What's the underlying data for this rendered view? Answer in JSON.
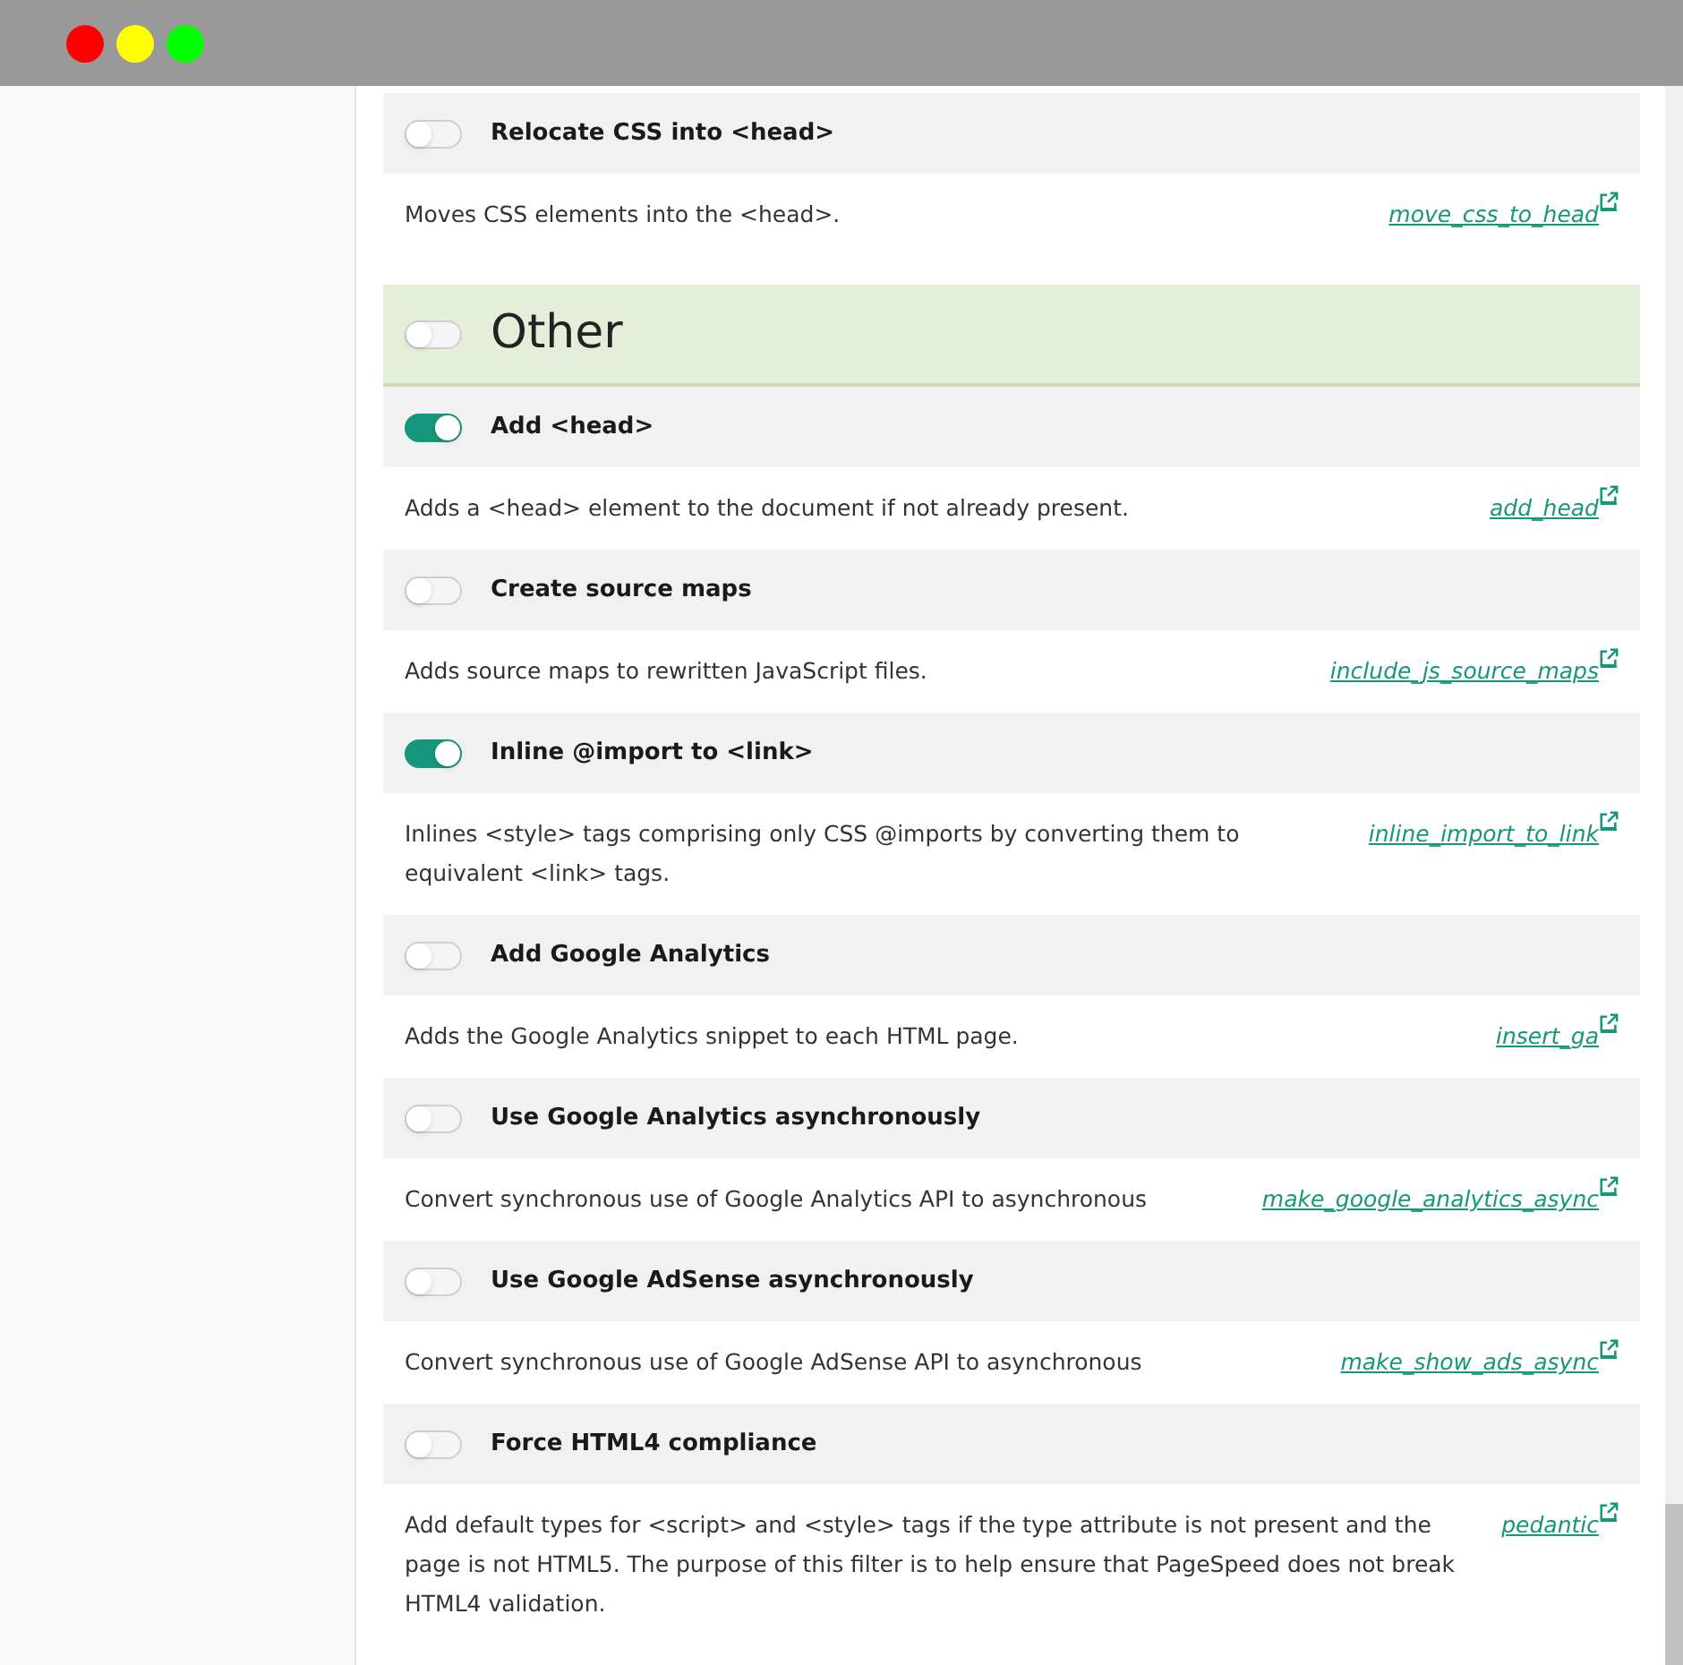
{
  "items": [
    {
      "kind": "filter",
      "title": "Relocate CSS into <head>",
      "on": false,
      "description": "Moves CSS elements into the <head>.",
      "link": "move_css_to_head"
    },
    {
      "kind": "section",
      "title": "Other",
      "on": false
    },
    {
      "kind": "filter",
      "title": "Add <head>",
      "on": true,
      "description": "Adds a <head> element to the document if not already present.",
      "link": "add_head"
    },
    {
      "kind": "filter",
      "title": "Create source maps",
      "on": false,
      "description": "Adds source maps to rewritten JavaScript files.",
      "link": "include_js_source_maps"
    },
    {
      "kind": "filter",
      "title": "Inline @import to <link>",
      "on": true,
      "description": "Inlines <style> tags comprising only CSS @imports by converting them to equivalent <link> tags.",
      "link": "inline_import_to_link"
    },
    {
      "kind": "filter",
      "title": "Add Google Analytics",
      "on": false,
      "description": "Adds the Google Analytics snippet to each HTML page.",
      "link": "insert_ga"
    },
    {
      "kind": "filter",
      "title": "Use Google Analytics asynchronously",
      "on": false,
      "description": "Convert synchronous use of Google Analytics API to asynchronous",
      "link": "make_google_analytics_async"
    },
    {
      "kind": "filter",
      "title": "Use Google AdSense asynchronously",
      "on": false,
      "description": "Convert synchronous use of Google AdSense API to asynchronous",
      "link": "make_show_ads_async"
    },
    {
      "kind": "filter",
      "title": "Force HTML4 compliance",
      "on": false,
      "description": "Add default types for <script> and <style> tags if the type attribute is not present and the page is not HTML5. The purpose of this filter is to help ensure that PageSpeed does not break HTML4 validation.",
      "link": "pedantic"
    }
  ]
}
